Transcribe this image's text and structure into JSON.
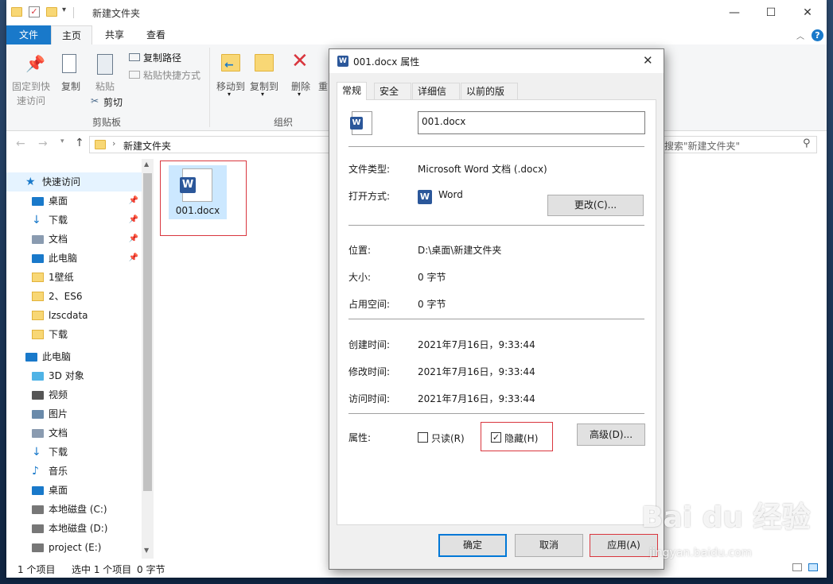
{
  "explorer": {
    "title": "新建文件夹",
    "tabs": [
      "文件",
      "主页",
      "共享",
      "查看"
    ],
    "ribbon": {
      "pin_label": "固定到快速访问",
      "pin_line1": "固定到快",
      "pin_line2": "速访问",
      "copy": "复制",
      "paste": "粘贴",
      "copy_path": "复制路径",
      "paste_shortcut": "粘贴快捷方式",
      "cut": "剪切",
      "clipboard_group": "剪贴板",
      "move_to": "移动到",
      "copy_to": "复制到",
      "delete": "删除",
      "rename_partial": "重",
      "organize_group": "组织"
    },
    "address": {
      "path": "新建文件夹",
      "search_placeholder": "搜索\"新建文件夹\""
    },
    "nav": [
      {
        "label": "快速访问",
        "icon": "star-icon"
      },
      {
        "label": "桌面",
        "icon": "desktop-icon",
        "pinned": true
      },
      {
        "label": "下载",
        "icon": "download-icon",
        "pinned": true
      },
      {
        "label": "文档",
        "icon": "document-icon",
        "pinned": true
      },
      {
        "label": "此电脑",
        "icon": "computer-icon",
        "pinned": true
      },
      {
        "label": "1壁纸",
        "icon": "folder-icon"
      },
      {
        "label": "2、ES6",
        "icon": "folder-icon"
      },
      {
        "label": "lzscdata",
        "icon": "folder-icon"
      },
      {
        "label": "下载",
        "icon": "folder-icon"
      },
      {
        "label": "此电脑",
        "icon": "computer-icon"
      },
      {
        "label": "3D 对象",
        "icon": "cube-icon"
      },
      {
        "label": "视频",
        "icon": "video-icon"
      },
      {
        "label": "图片",
        "icon": "picture-icon"
      },
      {
        "label": "文档",
        "icon": "document-icon"
      },
      {
        "label": "下载",
        "icon": "download-icon"
      },
      {
        "label": "音乐",
        "icon": "music-icon"
      },
      {
        "label": "桌面",
        "icon": "desktop-icon"
      },
      {
        "label": "本地磁盘 (C:)",
        "icon": "drive-icon"
      },
      {
        "label": "本地磁盘 (D:)",
        "icon": "drive-icon"
      },
      {
        "label": "project (E:)",
        "icon": "drive-icon"
      }
    ],
    "file": {
      "name": "001.docx"
    },
    "status": {
      "items": "1 个项目",
      "selected": "选中 1 个项目",
      "size": "0 字节"
    }
  },
  "dialog": {
    "title": "001.docx 属性",
    "tabs": [
      "常规",
      "安全",
      "详细信息",
      "以前的版本"
    ],
    "file_name": "001.docx",
    "labels": {
      "file_type": "文件类型:",
      "open_with": "打开方式:",
      "location": "位置:",
      "size": "大小:",
      "size_on_disk": "占用空间:",
      "created": "创建时间:",
      "modified": "修改时间:",
      "accessed": "访问时间:",
      "attributes": "属性:"
    },
    "values": {
      "file_type": "Microsoft Word 文档 (.docx)",
      "open_with": "Word",
      "location": "D:\\桌面\\新建文件夹",
      "size": "0 字节",
      "size_on_disk": "0 字节",
      "created": "2021年7月16日，9:33:44",
      "modified": "2021年7月16日，9:33:44",
      "accessed": "2021年7月16日，9:33:44"
    },
    "change_button": "更改(C)...",
    "readonly_label": "只读(R)",
    "readonly_checked": false,
    "hidden_label": "隐藏(H)",
    "hidden_checked": true,
    "advanced_button": "高级(D)...",
    "ok": "确定",
    "cancel": "取消",
    "apply": "应用(A)"
  },
  "watermark": {
    "brand": "Bai du 经验",
    "url": "jingyan.baidu.com"
  }
}
